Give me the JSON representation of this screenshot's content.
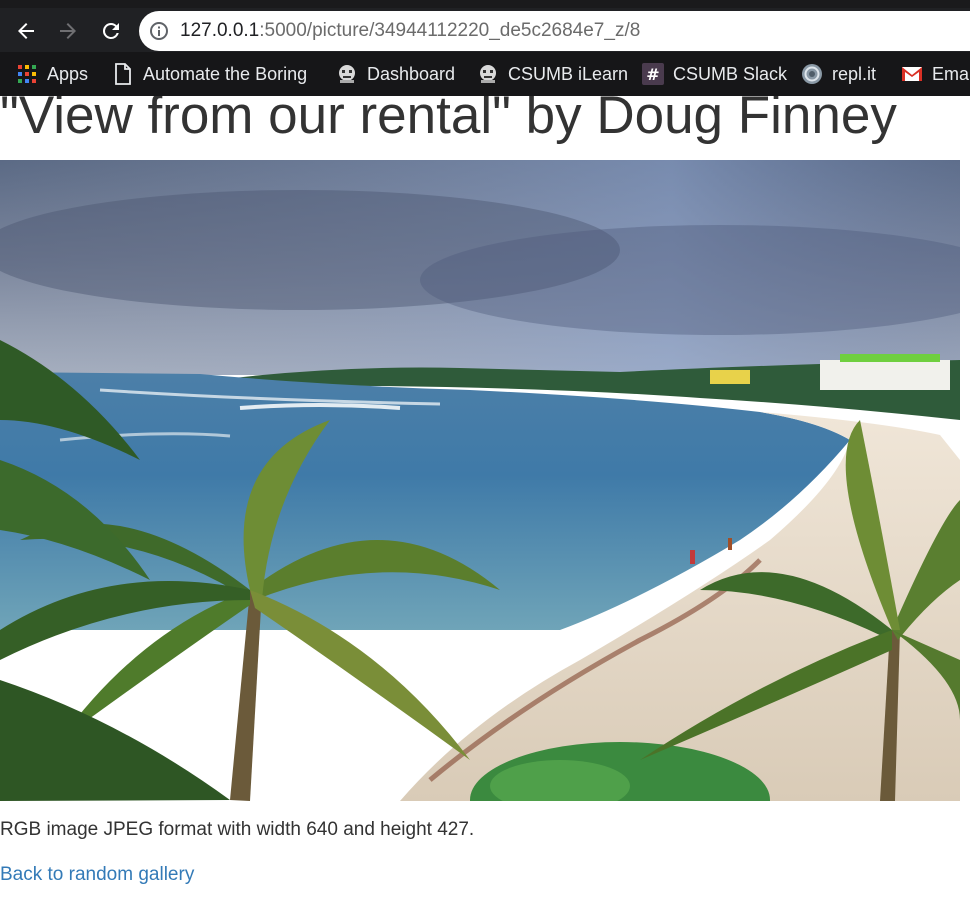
{
  "browser": {
    "url_host": "127.0.0.1",
    "url_rest": ":5000/picture/34944112220_de5c2684e7_z/8",
    "bookmarks": [
      {
        "label": "Apps",
        "icon": "apps-grid-icon"
      },
      {
        "label": "Automate the Boring",
        "icon": "page-icon"
      },
      {
        "label": "Dashboard",
        "icon": "favicon-icon"
      },
      {
        "label": "CSUMB iLearn",
        "icon": "favicon-icon"
      },
      {
        "label": "CSUMB Slack",
        "icon": "slack-hash-icon"
      },
      {
        "label": "repl.it",
        "icon": "repl-icon"
      },
      {
        "label": "Ema",
        "icon": "gmail-icon"
      }
    ]
  },
  "page": {
    "title": "\"View from our rental\" by Doug Finney",
    "meta": "RGB image JPEG format with width 640 and height 427.",
    "back_link": "Back to random gallery"
  },
  "colors": {
    "toolbar": "#202124",
    "bookmarks_bar": "#161618",
    "link": "#337ab7",
    "text": "#333333"
  }
}
